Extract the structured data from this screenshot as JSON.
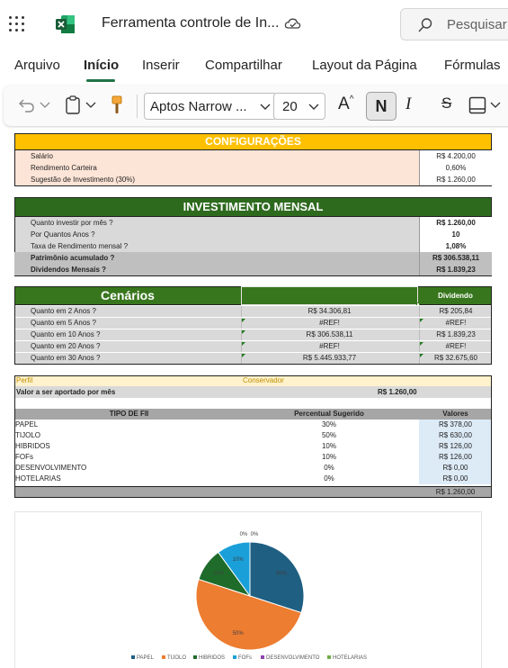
{
  "app": {
    "title": "Ferramenta controle de In...",
    "search_placeholder": "Pesquisar",
    "icons": [
      "app-launcher-icon",
      "excel-logo-icon",
      "cloud-saved-icon",
      "search-icon"
    ]
  },
  "ribbon": {
    "tabs": [
      "Arquivo",
      "Início",
      "Inserir",
      "Compartilhar",
      "Layout da Página",
      "Fórmulas"
    ],
    "active_tab": "Início",
    "font_name": "Aptos Narrow ...",
    "font_size": "20",
    "bold_label": "N",
    "italic_label": "I",
    "strike_label": "S",
    "grow_font_label": "A^"
  },
  "colors": {
    "config_header": "#ffc000",
    "green_header": "#2d6a1e",
    "cenario_header": "#38761d",
    "peach": "#fce4d6",
    "grey_row": "#d9d9d9",
    "values_blue": "#ddebf7",
    "perfil_yellow": "#fff2cc"
  },
  "config": {
    "title": "CONFIGURAÇÕES",
    "rows": [
      {
        "label": "Salário",
        "value": "R$ 4.200,00"
      },
      {
        "label": "Rendimento Carteira",
        "value": "0,60%"
      },
      {
        "label": "Sugestão de Investimento (30%)",
        "value": "R$ 1.260,00"
      }
    ]
  },
  "investimento": {
    "title": "INVESTIMENTO MENSAL",
    "rows": [
      {
        "label": "Quanto investir por mês ?",
        "value": "R$ 1.260,00"
      },
      {
        "label": "Por Quantos Anos ?",
        "value": "10"
      },
      {
        "label": "Taxa de Rendimento mensal ?",
        "value": "1,08%"
      },
      {
        "label": "Patrimônio acumulado ?",
        "value": "R$ 306.538,11"
      },
      {
        "label": "Dividendos Mensais ?",
        "value": "R$ 1.839,23"
      }
    ]
  },
  "cenarios": {
    "title": "Cenários",
    "dividend_header": "Dividendo",
    "rows": [
      {
        "label": "Quanto em 2 Anos ?",
        "value": "R$ 34.306,81",
        "dividend": "R$ 205,84"
      },
      {
        "label": "Quanto em 5 Anos ?",
        "value": "#REF!",
        "dividend": "#REF!"
      },
      {
        "label": "Quanto em 10 Anos ?",
        "value": "R$ 306.538,11",
        "dividend": "R$ 1.839,23"
      },
      {
        "label": "Quanto em 20 Anos ?",
        "value": "#REF!",
        "dividend": "#REF!"
      },
      {
        "label": "Quanto em 30 Anos ?",
        "value": "R$ 5.445.933,77",
        "dividend": "R$ 32.675,60"
      }
    ]
  },
  "perfil": {
    "label": "Perfil",
    "value": "Conservador",
    "aporte_label": "Valor a ser aportado por mês",
    "aporte_value": "R$ 1.260,00"
  },
  "fii": {
    "headers": [
      "TIPO DE FII",
      "Percentual Sugerido",
      "Valores"
    ],
    "rows": [
      {
        "tipo": "PAPEL",
        "pct": "30%",
        "valor": "R$ 378,00"
      },
      {
        "tipo": "TIJOLO",
        "pct": "50%",
        "valor": "R$ 630,00"
      },
      {
        "tipo": "HIBRIDOS",
        "pct": "10%",
        "valor": "R$ 126,00"
      },
      {
        "tipo": "FOFs",
        "pct": "10%",
        "valor": "R$ 126,00"
      },
      {
        "tipo": "DESENVOLVIMENTO",
        "pct": "0%",
        "valor": "R$ 0,00"
      },
      {
        "tipo": "HOTELARIAS",
        "pct": "0%",
        "valor": "R$ 0,00"
      }
    ],
    "total": "R$ 1.260,00"
  },
  "chart_data": {
    "type": "pie",
    "categories": [
      "PAPEL",
      "TIJOLO",
      "HIBRIDOS",
      "FOFs",
      "DESENVOLVIMENTO",
      "HOTELARIAS"
    ],
    "values": [
      30,
      50,
      10,
      10,
      0,
      0
    ],
    "slice_labels": [
      "30%",
      "50%",
      "10%",
      "10%",
      "0%",
      "0%"
    ],
    "colors": [
      "#1f5f82",
      "#ed7d31",
      "#1e6b2a",
      "#1a9fd9",
      "#8e44ad",
      "#70ad47"
    ],
    "legend": "bottom",
    "title": ""
  }
}
